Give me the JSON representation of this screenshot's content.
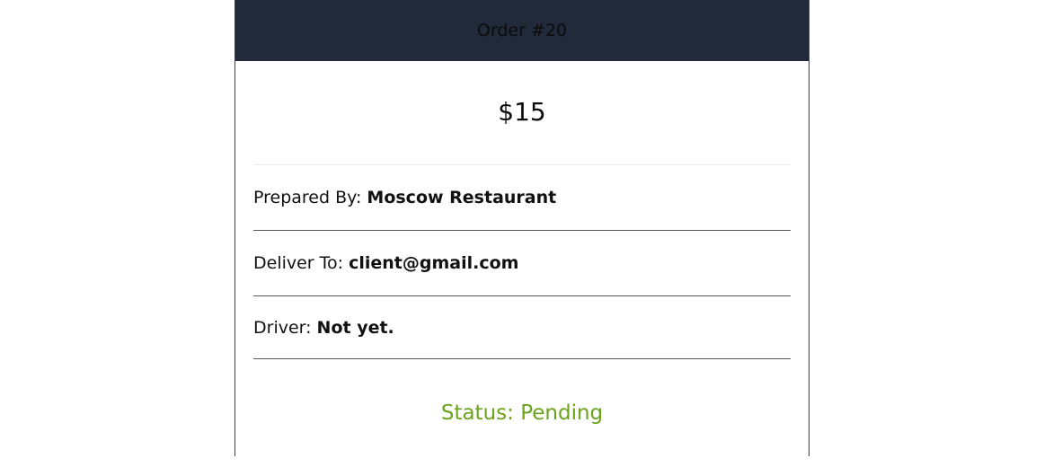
{
  "order": {
    "title": "Order #20",
    "price": "$15",
    "prepared_by_label": "Prepared By:",
    "prepared_by_value": "Moscow Restaurant",
    "deliver_to_label": "Deliver To:",
    "deliver_to_value": "client@gmail.com",
    "driver_label": "Driver:",
    "driver_value": "Not yet.",
    "status": "Status: Pending"
  },
  "colors": {
    "header_bg": "#212a3a",
    "status_text": "#6aa31d"
  }
}
